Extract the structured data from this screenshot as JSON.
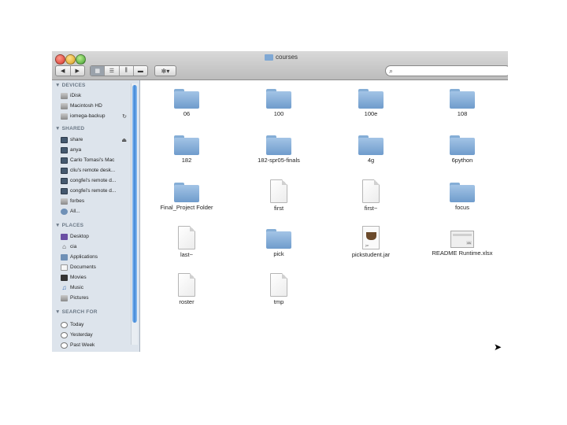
{
  "window": {
    "title": "courses"
  },
  "toolbar": {
    "back": "◀",
    "forward": "▶",
    "views": [
      "▦",
      "☰",
      "⫼",
      "▬"
    ],
    "action": "✻▾",
    "search_placeholder": ""
  },
  "sidebar": {
    "devices_heading": "▼ DEVICES",
    "devices": [
      "iDisk",
      "Macintosh HD",
      "iomega-backup"
    ],
    "shared_heading": "▼ SHARED",
    "shared": [
      "share",
      "anya",
      "Carlo Tomasi's Mac",
      "cliu's remote desk...",
      "congfei's remote d...",
      "congfei's remote d...",
      "forbes",
      "All..."
    ],
    "places_heading": "▼ PLACES",
    "places": [
      "Desktop",
      "cia",
      "Applications",
      "Documents",
      "Movies",
      "Music",
      "Pictures"
    ],
    "search_heading": "▼ SEARCH FOR",
    "search_for": [
      "Today",
      "Yesterday",
      "Past Week"
    ]
  },
  "files": [
    {
      "name": "06",
      "kind": "folder"
    },
    {
      "name": "100",
      "kind": "folder"
    },
    {
      "name": "100e",
      "kind": "folder"
    },
    {
      "name": "108",
      "kind": "folder"
    },
    {
      "name": "182",
      "kind": "folder"
    },
    {
      "name": "182-spr05-finals",
      "kind": "folder"
    },
    {
      "name": "4g",
      "kind": "folder"
    },
    {
      "name": "6python",
      "kind": "folder"
    },
    {
      "name": "Final_Project Folder",
      "kind": "folder"
    },
    {
      "name": "first",
      "kind": "document"
    },
    {
      "name": "first~",
      "kind": "document"
    },
    {
      "name": "focus",
      "kind": "folder"
    },
    {
      "name": "last~",
      "kind": "document"
    },
    {
      "name": "pick",
      "kind": "folder"
    },
    {
      "name": "pickstudent.jar",
      "kind": "jar"
    },
    {
      "name": "README Runtime.xlsx",
      "kind": "spreadsheet"
    },
    {
      "name": "roster",
      "kind": "document"
    },
    {
      "name": "tmp",
      "kind": "document"
    }
  ],
  "icons": {
    "cursor": "mouse-pointer-icon",
    "jar_badge": "jar",
    "xlsx_badge": "xls"
  }
}
